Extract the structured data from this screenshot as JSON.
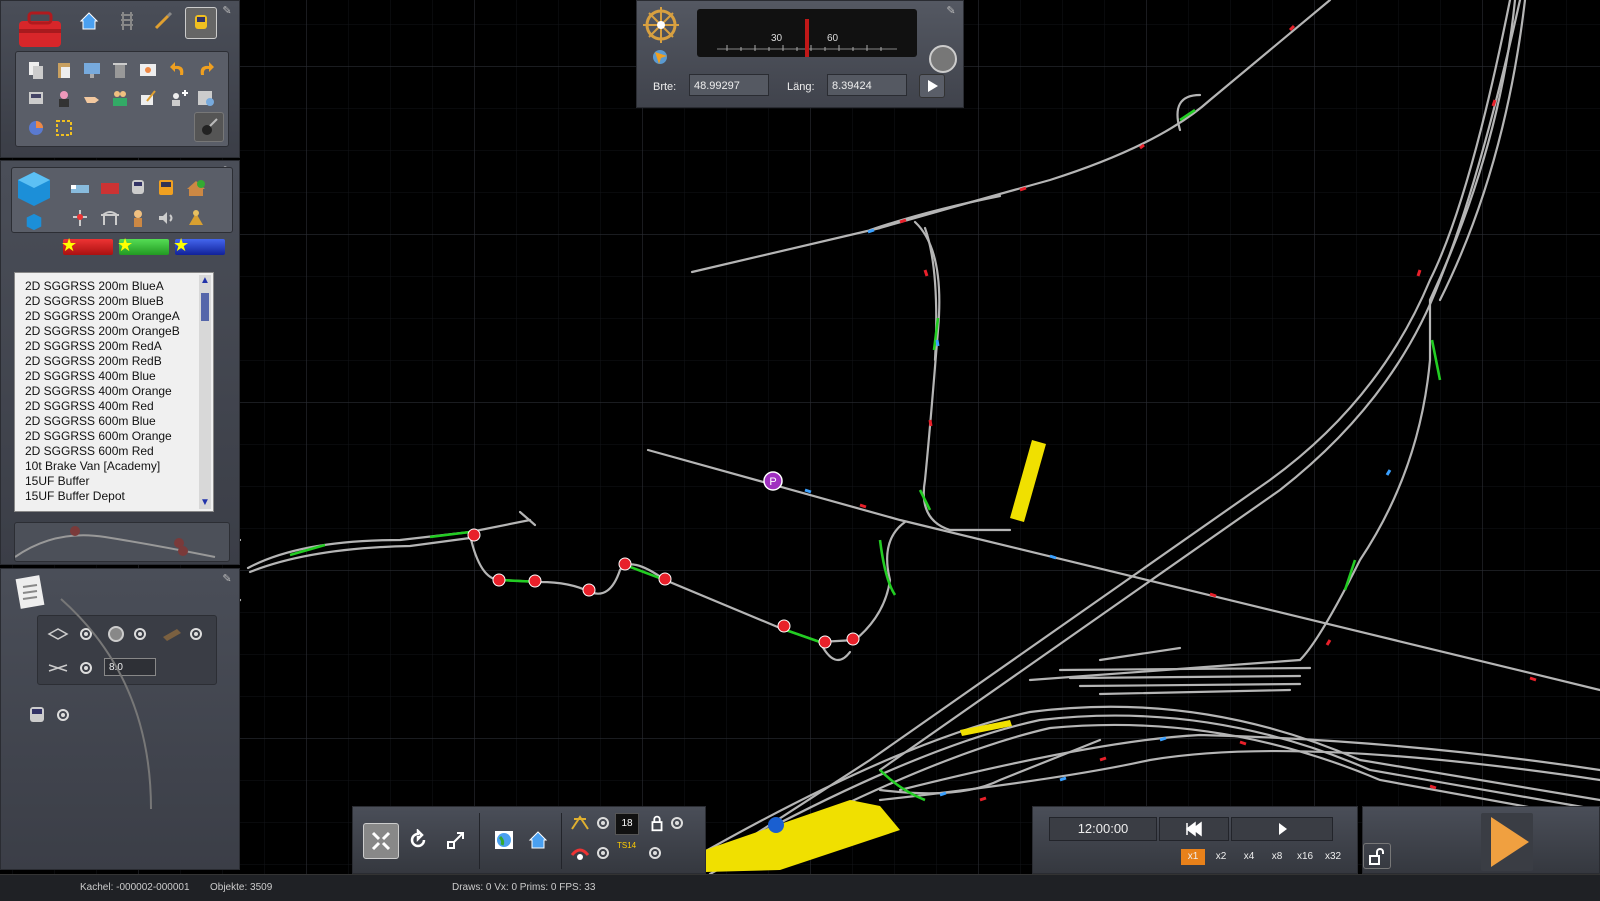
{
  "coords": {
    "lat_label": "Brte:",
    "lat_value": "48.99297",
    "lon_label": "Läng:",
    "lon_value": "8.39424"
  },
  "gauge": {
    "tick_a": "30",
    "tick_b": "60"
  },
  "assets": [
    "2D SGGRSS 200m BlueA",
    "2D SGGRSS 200m BlueB",
    "2D SGGRSS 200m OrangeA",
    "2D SGGRSS 200m OrangeB",
    "2D SGGRSS 200m RedA",
    "2D SGGRSS 200m RedB",
    "2D SGGRSS 400m Blue",
    "2D SGGRSS 400m Orange",
    "2D SGGRSS 400m Red",
    "2D SGGRSS 600m Blue",
    "2D SGGRSS 600m Orange",
    "2D SGGRSS 600m Red",
    "10t Brake Van [Academy]",
    "15UF Buffer",
    "15UF Buffer Depot"
  ],
  "props": {
    "value_field": "8.0"
  },
  "bottom_tools": {
    "counter": "18",
    "weather_label": "TS14"
  },
  "time": {
    "clock": "12:00:00",
    "speeds": [
      "x1",
      "x2",
      "x4",
      "x8",
      "x16",
      "x32"
    ],
    "active_speed": "x1"
  },
  "status": {
    "tile": "Kachel: -000002-000001",
    "objects": "Objekte: 3509",
    "draws": "Draws: 0 Vx: 0 Prims: 0 FPS: 33"
  },
  "map_labels": {
    "parking": "P"
  },
  "colors": {
    "track": "#b8b8b8",
    "selected_track": "#22cc22",
    "node": "#e8202a",
    "platform": "#f0e000",
    "accent": "#e8811a"
  }
}
